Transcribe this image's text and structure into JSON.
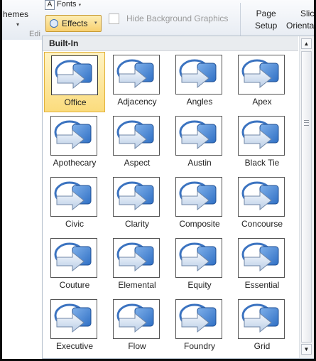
{
  "ribbon": {
    "themes_label": "hemes",
    "themes_caret": "▾",
    "fonts_label": "Fonts",
    "fonts_glyph": "A",
    "fonts_caret": "▾",
    "effects_label": "Effects",
    "effects_caret": "▾",
    "hide_background_label": "Hide Background Graphics",
    "page_setup_line1": "Page",
    "page_setup_line2": "Setup",
    "slide_orientation_line1": "Slic",
    "slide_orientation_line2": "Orienta",
    "edit_group_label": "Edi"
  },
  "gallery": {
    "section_title": "Built-In",
    "selected": "Office",
    "items": [
      {
        "label": "Office"
      },
      {
        "label": "Adjacency"
      },
      {
        "label": "Angles"
      },
      {
        "label": "Apex"
      },
      {
        "label": "Apothecary"
      },
      {
        "label": "Aspect"
      },
      {
        "label": "Austin"
      },
      {
        "label": "Black Tie"
      },
      {
        "label": "Civic"
      },
      {
        "label": "Clarity"
      },
      {
        "label": "Composite"
      },
      {
        "label": "Concourse"
      },
      {
        "label": "Couture"
      },
      {
        "label": "Elemental"
      },
      {
        "label": "Equity"
      },
      {
        "label": "Essential"
      },
      {
        "label": "Executive"
      },
      {
        "label": "Flow"
      },
      {
        "label": "Foundry"
      },
      {
        "label": "Grid"
      }
    ]
  },
  "scrollbar": {
    "up_glyph": "▲",
    "down_glyph": "▼"
  },
  "colors": {
    "accent_blue": "#2f6fc4",
    "selected_fill": "#fbdc7d",
    "selected_border": "#e2b23a"
  }
}
